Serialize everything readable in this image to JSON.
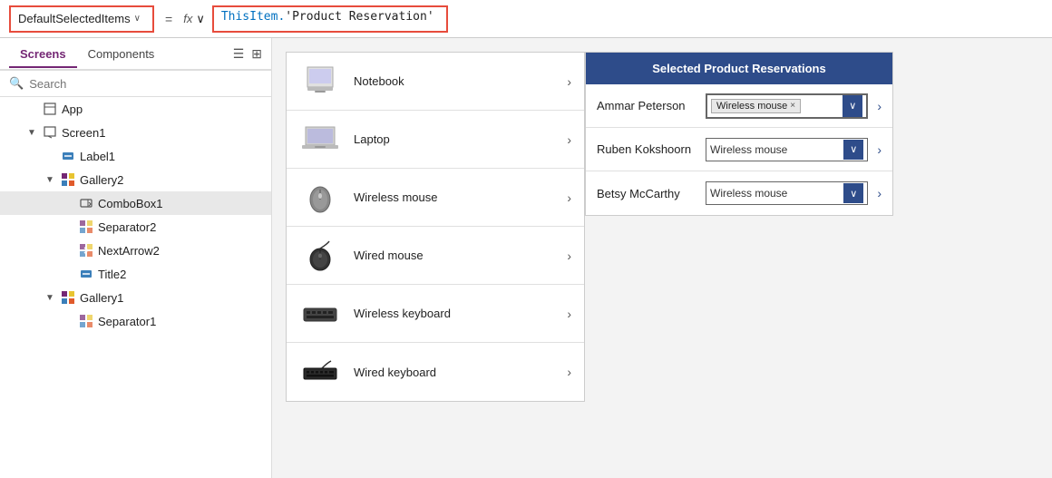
{
  "formulaBar": {
    "propertyLabel": "DefaultSelectedItems",
    "eqSign": "=",
    "fxLabel": "fx",
    "chevronDown": "∨",
    "formula": "ThisItem.'Product Reservation'",
    "formulaKeyword": "ThisItem.",
    "formulaString": "'Product Reservation'"
  },
  "sidebar": {
    "tabs": [
      {
        "id": "screens",
        "label": "Screens",
        "active": true
      },
      {
        "id": "components",
        "label": "Components",
        "active": false
      }
    ],
    "searchPlaceholder": "Search",
    "treeItems": [
      {
        "id": "app",
        "label": "App",
        "indent": 0,
        "icon": "app",
        "arrow": ""
      },
      {
        "id": "screen1",
        "label": "Screen1",
        "indent": 0,
        "icon": "screen",
        "arrow": "▼"
      },
      {
        "id": "label1",
        "label": "Label1",
        "indent": 1,
        "icon": "label",
        "arrow": ""
      },
      {
        "id": "gallery2",
        "label": "Gallery2",
        "indent": 1,
        "icon": "gallery",
        "arrow": "▼"
      },
      {
        "id": "combobox1",
        "label": "ComboBox1",
        "indent": 2,
        "icon": "combobox",
        "arrow": "",
        "selected": true
      },
      {
        "id": "separator2",
        "label": "Separator2",
        "indent": 2,
        "icon": "separator",
        "arrow": ""
      },
      {
        "id": "nextarrow2",
        "label": "NextArrow2",
        "indent": 2,
        "icon": "nextarrow",
        "arrow": ""
      },
      {
        "id": "title2",
        "label": "Title2",
        "indent": 2,
        "icon": "title",
        "arrow": ""
      },
      {
        "id": "gallery1",
        "label": "Gallery1",
        "indent": 1,
        "icon": "gallery",
        "arrow": "▼"
      },
      {
        "id": "separator1",
        "label": "Separator1",
        "indent": 2,
        "icon": "separator",
        "arrow": ""
      }
    ]
  },
  "gallery": {
    "items": [
      {
        "id": "notebook",
        "label": "Notebook",
        "iconType": "notebook"
      },
      {
        "id": "laptop",
        "label": "Laptop",
        "iconType": "laptop"
      },
      {
        "id": "wireless-mouse",
        "label": "Wireless mouse",
        "iconType": "wireless-mouse"
      },
      {
        "id": "wired-mouse",
        "label": "Wired mouse",
        "iconType": "wired-mouse"
      },
      {
        "id": "wireless-keyboard",
        "label": "Wireless keyboard",
        "iconType": "wireless-keyboard"
      },
      {
        "id": "wired-keyboard",
        "label": "Wired keyboard",
        "iconType": "wired-keyboard"
      }
    ]
  },
  "rightPanel": {
    "title": "Selected Product Reservations",
    "rows": [
      {
        "id": "ammar",
        "name": "Ammar Peterson",
        "value": "Wireless mouse",
        "expanded": true
      },
      {
        "id": "ruben",
        "name": "Ruben Kokshoorn",
        "value": "Wireless mouse",
        "expanded": false
      },
      {
        "id": "betsy",
        "name": "Betsy McCarthy",
        "value": "Wireless mouse",
        "expanded": false
      }
    ]
  },
  "colors": {
    "accent": "#742774",
    "formula_border": "#e74c3c",
    "panel_bg": "#2e4c8a",
    "selected_bg": "#e8e8e8"
  }
}
